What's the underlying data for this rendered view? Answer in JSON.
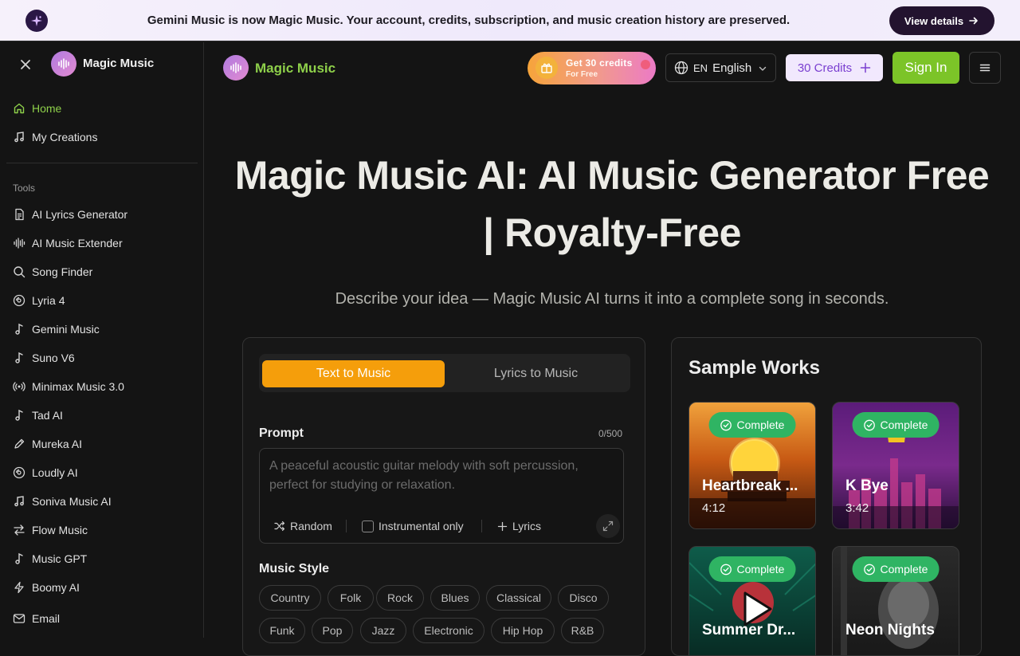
{
  "banner": {
    "message": "Gemini Music is now Magic Music. Your account, credits, subscription, and music creation history are preserved.",
    "button_label": "View details",
    "icon": "sparkle-icon"
  },
  "sidebar": {
    "brand": "Magic Music",
    "nav": [
      {
        "label": "Home",
        "icon": "home-icon",
        "active": true
      },
      {
        "label": "My Creations",
        "icon": "music-notes-icon",
        "active": false
      }
    ],
    "section_title": "Tools",
    "tools": [
      {
        "label": "AI Lyrics Generator",
        "icon": "document-icon"
      },
      {
        "label": "AI Music Extender",
        "icon": "waveform-icon"
      },
      {
        "label": "Song Finder",
        "icon": "search-icon"
      },
      {
        "label": "Lyria 4",
        "icon": "disc-icon"
      },
      {
        "label": "Gemini Music",
        "icon": "music-note-icon"
      },
      {
        "label": "Suno V6",
        "icon": "music-note-icon"
      },
      {
        "label": "Minimax Music 3.0",
        "icon": "radio-waves-icon"
      },
      {
        "label": "Tad AI",
        "icon": "music-note-icon"
      },
      {
        "label": "Mureka AI",
        "icon": "pen-icon"
      },
      {
        "label": "Loudly AI",
        "icon": "disc-icon"
      },
      {
        "label": "Soniva Music AI",
        "icon": "music-notes-icon"
      },
      {
        "label": "Flow Music",
        "icon": "arrows-swap-icon"
      },
      {
        "label": "Music GPT",
        "icon": "music-note-icon"
      },
      {
        "label": "Boomy AI",
        "icon": "lightning-icon"
      },
      {
        "label": "Email",
        "icon": "mail-icon"
      }
    ]
  },
  "header": {
    "brand": "Magic Music",
    "promo": {
      "title": "Get 30 credits",
      "subtitle": "For Free"
    },
    "language": {
      "code": "EN",
      "label": "English"
    },
    "credits_label": "30 Credits",
    "signin_label": "Sign In"
  },
  "hero": {
    "title_line1": "Magic Music AI: AI Music Generator Free",
    "title_line2": "| Royalty-Free",
    "subtitle": "Describe your idea — Magic Music AI turns it into a complete song in seconds."
  },
  "generator": {
    "tabs": [
      {
        "label": "Text to Music",
        "active": true
      },
      {
        "label": "Lyrics to Music",
        "active": false
      }
    ],
    "prompt_label": "Prompt",
    "prompt_count": "0/500",
    "prompt_value": "",
    "prompt_placeholder": "A peaceful acoustic guitar melody with soft percussion, perfect for studying or relaxation.",
    "tools": {
      "random": "Random",
      "instrumental": "Instrumental only",
      "instrumental_checked": false,
      "lyrics": "Lyrics"
    },
    "style_label": "Music Style",
    "styles": [
      "Country",
      "Folk",
      "Rock",
      "Blues",
      "Classical",
      "Disco",
      "Funk",
      "Pop",
      "Jazz",
      "Electronic",
      "Hip Hop",
      "R&B"
    ]
  },
  "works": {
    "title": "Sample Works",
    "items": [
      {
        "status": "Complete",
        "name": "Heartbreak ...",
        "duration": "4:12"
      },
      {
        "status": "Complete",
        "name": "K Bye",
        "duration": "3:42"
      },
      {
        "status": "Complete",
        "name": "Summer Dr...",
        "duration": ""
      },
      {
        "status": "Complete",
        "name": "Neon Nights",
        "duration": ""
      }
    ]
  },
  "colors": {
    "accent_green": "#8ed04a",
    "signin_green": "#7cc428",
    "tab_orange": "#f59e0b",
    "credits_purple": "#7a3fd0",
    "badge_green": "#2fb463"
  }
}
